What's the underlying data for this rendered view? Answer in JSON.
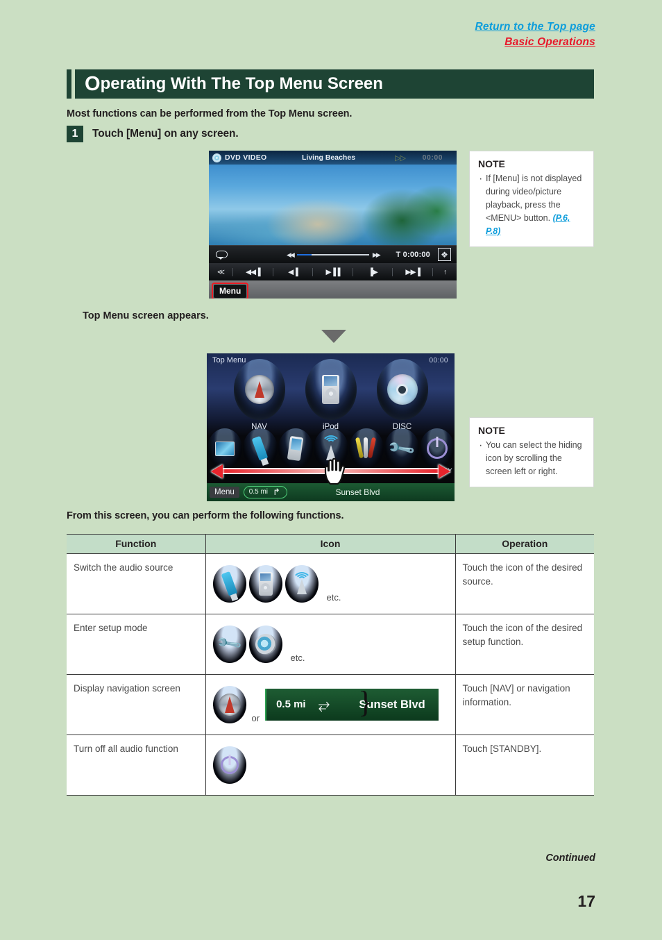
{
  "header": {
    "return_link": "Return to the Top page",
    "section_link": "Basic Operations"
  },
  "title": {
    "first_letter": "O",
    "rest": "perating With The Top Menu Screen"
  },
  "intro": "Most functions can be performed from the Top Menu screen.",
  "step": {
    "number": "1",
    "text": "Touch [Menu] on any screen."
  },
  "dvd_screen": {
    "source_label": "DVD VIDEO",
    "title": "Living Beaches",
    "ff_indicator": "▷▷",
    "clock": "00:00",
    "time_label": "T 0:00:00",
    "transport": [
      "≪",
      "◀◀▐",
      "◀▐",
      "▶▐▐",
      "▐▶",
      "▶▶▐",
      "↑"
    ],
    "menu_button": "Menu"
  },
  "note_1": {
    "heading": "NOTE",
    "body": "If [Menu] is not displayed during video/picture playback, press the <MENU> button.",
    "link": "(P.6, P.8)"
  },
  "appears_text": "Top Menu screen appears.",
  "top_menu_screen": {
    "label": "Top Menu",
    "clock": "00:00",
    "primary_icons": [
      {
        "name": "NAV",
        "icon": "compass-icon"
      },
      {
        "name": "iPod",
        "icon": "ipod-icon"
      },
      {
        "name": "DISC",
        "icon": "disc-icon"
      }
    ],
    "secondary_icons": [
      {
        "name": "TV",
        "icon": "tv-icon"
      },
      {
        "name": "USB",
        "icon": "usb-icon"
      },
      {
        "name": "iPhone",
        "icon": "phone-icon"
      },
      {
        "name": "TUNER",
        "icon": "radio-antenna-icon"
      },
      {
        "name": "VIDEO",
        "icon": "av-cable-icon"
      },
      {
        "name": "SETUP",
        "icon": "wrench-icon"
      },
      {
        "name": "STANDBY",
        "icon": "power-icon"
      }
    ],
    "menu_button": "Menu",
    "distance": "0.5 mi",
    "turn_arrow": "↱",
    "street": "Sunset Blvd"
  },
  "note_2": {
    "heading": "NOTE",
    "body": "You can select the hiding icon by scrolling the screen left or right."
  },
  "from_this_screen": "From this screen, you can perform the following functions.",
  "table": {
    "headers": [
      "Function",
      "Icon",
      "Operation"
    ],
    "rows": [
      {
        "function": "Switch the audio source",
        "icons": [
          "usb-icon",
          "ipod-icon",
          "radio-antenna-icon"
        ],
        "icon_suffix": "etc.",
        "operation": "Touch the icon of the desired source."
      },
      {
        "function": "Enter setup mode",
        "icons": [
          "wrench-icon",
          "speaker-icon"
        ],
        "icon_suffix": "etc.",
        "operation": "Touch the icon of the desired setup function."
      },
      {
        "function": "Display navigation screen",
        "icons": [
          "compass-icon",
          "nav-bar"
        ],
        "icon_suffix": "or",
        "nav_distance": "0.5 mi",
        "nav_street": "Sunset Blvd",
        "operation": "Touch [NAV] or navigation information."
      },
      {
        "function": "Turn off all audio function",
        "icons": [
          "power-icon"
        ],
        "icon_suffix": "",
        "operation": "Touch [STANDBY]."
      }
    ]
  },
  "footer": {
    "continued": "Continued",
    "page_number": "17"
  },
  "colors": {
    "page_background": "#cbdfc3",
    "banner": "#1e4434",
    "link_blue": "#0d9ddb",
    "link_red": "#e8172a",
    "table_header": "#c3ddc8",
    "highlight_red": "#ed1c24"
  }
}
